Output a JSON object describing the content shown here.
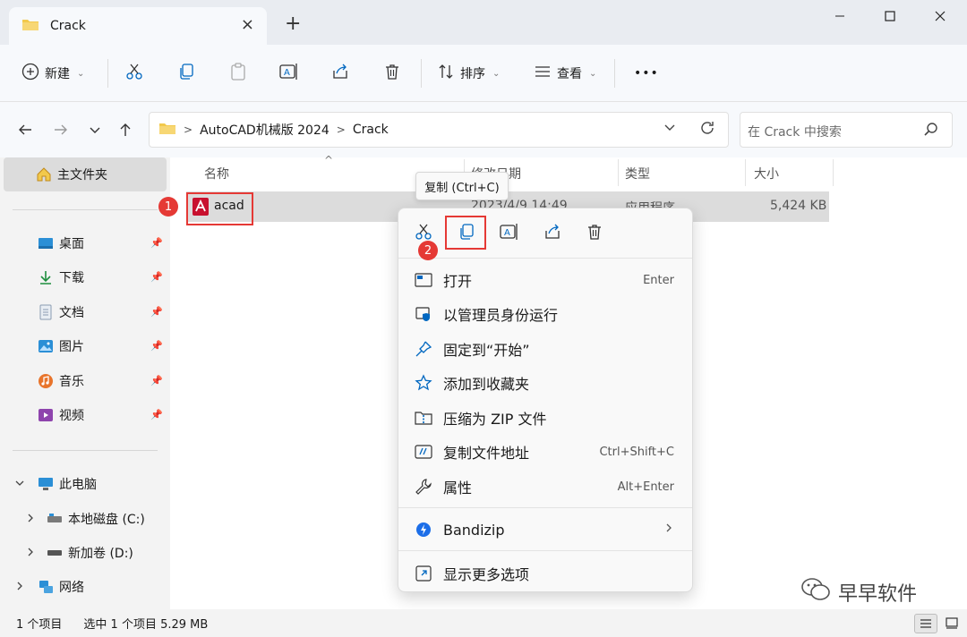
{
  "tab": {
    "title": "Crack",
    "close": "×",
    "new": "+"
  },
  "window": {
    "minimize": "—",
    "maximize": "□",
    "close": "✕"
  },
  "command_bar": {
    "new_label": "新建",
    "sort_label": "排序",
    "view_label": "查看",
    "more_label": "•••"
  },
  "address": {
    "crumbs": [
      "AutoCAD机械版 2024",
      "Crack"
    ],
    "separator": ">"
  },
  "search": {
    "placeholder": "在 Crack 中搜索"
  },
  "sidebar": {
    "home": "主文件夹",
    "quick_access": [
      {
        "label": "桌面"
      },
      {
        "label": "下载"
      },
      {
        "label": "文档"
      },
      {
        "label": "图片"
      },
      {
        "label": "音乐"
      },
      {
        "label": "视频"
      }
    ],
    "this_pc": "此电脑",
    "drives": [
      "本地磁盘 (C:)",
      "新加卷 (D:)"
    ],
    "network": "网络"
  },
  "columns": {
    "name": "名称",
    "date": "修改日期",
    "type": "类型",
    "size": "大小"
  },
  "file": {
    "name": "acad",
    "date": "2023/4/9 14:49",
    "type": "应用程序",
    "size": "5,424 KB"
  },
  "tooltip": "复制 (Ctrl+C)",
  "badges": [
    "1",
    "2"
  ],
  "context_menu": {
    "items": [
      {
        "label": "打开",
        "shortcut": "Enter"
      },
      {
        "label": "以管理员身份运行",
        "shortcut": ""
      },
      {
        "label": "固定到“开始”",
        "shortcut": ""
      },
      {
        "label": "添加到收藏夹",
        "shortcut": ""
      },
      {
        "label": "压缩为 ZIP 文件",
        "shortcut": ""
      },
      {
        "label": "复制文件地址",
        "shortcut": "Ctrl+Shift+C"
      },
      {
        "label": "属性",
        "shortcut": "Alt+Enter"
      }
    ],
    "bandizip": "Bandizip",
    "more_options": "显示更多选项"
  },
  "status": {
    "count": "1 个项目",
    "selected": "选中 1 个项目  5.29 MB"
  },
  "watermark": "早早软件",
  "colors": {
    "highlight_red": "#e53935",
    "folder_yellow": "#f2c94c",
    "accent_blue": "#0067c0"
  }
}
